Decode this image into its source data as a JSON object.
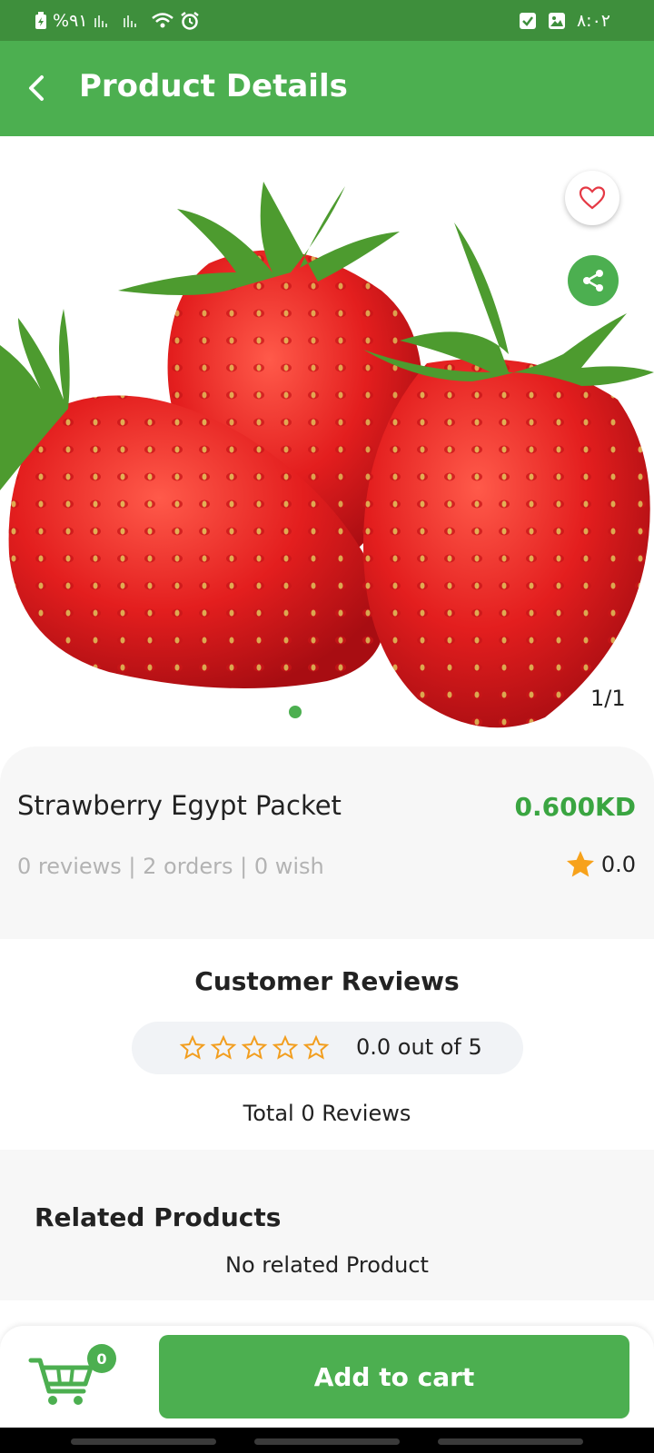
{
  "status_bar": {
    "battery": "%٩١",
    "time": "٨:٠٢"
  },
  "header": {
    "title": "Product Details"
  },
  "hero": {
    "image_counter": "1/1",
    "accent": "#4caf50"
  },
  "product": {
    "name": "Strawberry Egypt Packet",
    "price": "0.600KD",
    "meta": "0 reviews | 2 orders | 0 wish",
    "rating": "0.0"
  },
  "customer_reviews": {
    "title": "Customer Reviews",
    "rating_text": "0.0 out of 5",
    "total_text": "Total 0 Reviews"
  },
  "related": {
    "title": "Related Products",
    "empty_text": "No related Product"
  },
  "bottom": {
    "cart_count": "0",
    "add_to_cart_label": "Add to cart"
  },
  "colors": {
    "primary": "#4caf50",
    "status_bar": "#3e8f3c",
    "price": "#3aa541",
    "star": "#f7a21b"
  }
}
